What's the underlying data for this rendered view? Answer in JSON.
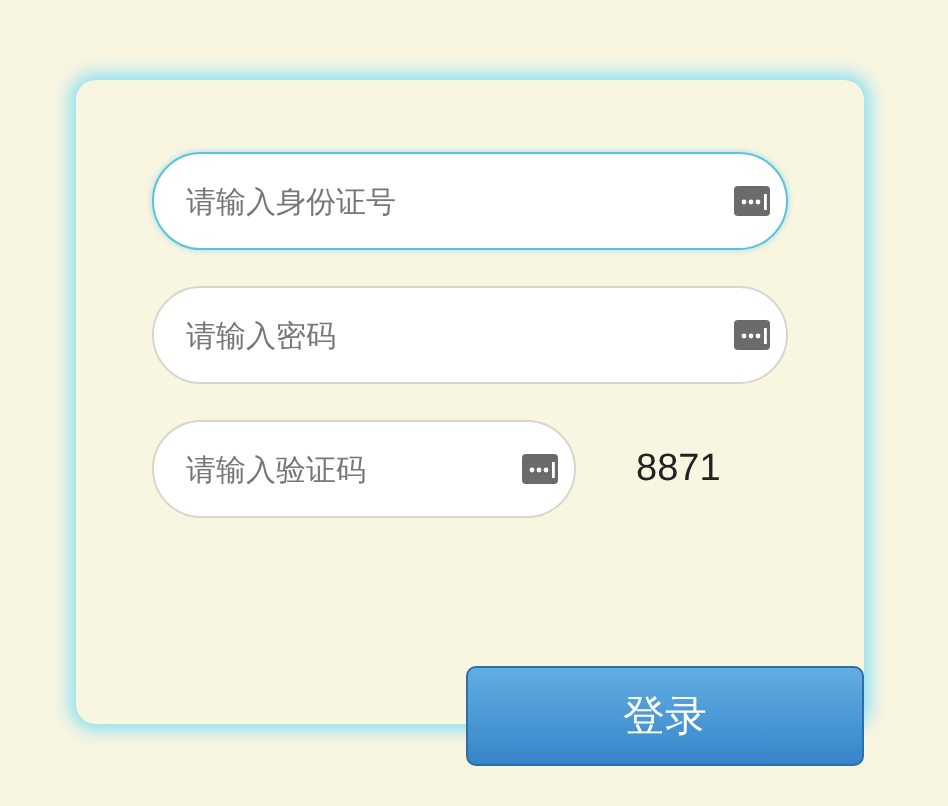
{
  "fields": [
    {
      "placeholder": "请输入身份证号",
      "focused": true,
      "kind": "wide"
    },
    {
      "placeholder": "请输入密码",
      "focused": false,
      "kind": "wide"
    },
    {
      "placeholder": "请输入验证码",
      "focused": false,
      "kind": "captcha",
      "code": "8871"
    }
  ],
  "login_button": {
    "label": "登录"
  }
}
